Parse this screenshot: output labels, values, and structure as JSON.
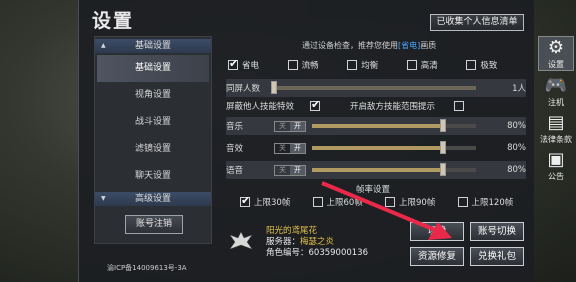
{
  "title": "设置",
  "top_button": "已收集个人信息清单",
  "left_menu": {
    "cat1": "基础设置",
    "items": [
      "基础设置",
      "视角设置",
      "战斗设置",
      "滤镜设置",
      "聊天设置"
    ],
    "cat2": "高级设置",
    "account_button": "账号注销",
    "icp": "渝ICP备14009613号-3A"
  },
  "hint": {
    "pre": "通过设备检查，推荐您使用",
    "link": "[省电]",
    "post": "画质"
  },
  "quality": [
    "省电",
    "流畅",
    "均衡",
    "高清",
    "极致"
  ],
  "rows": {
    "players_label": "同屏人数",
    "players_value": "1人",
    "hide_label": "屏蔽他人技能特效",
    "enemy_label": "开启敌方技能范围提示",
    "music": "音乐",
    "sfx": "音效",
    "voice": "语音",
    "off": "关",
    "on": "开",
    "music_value": "80%",
    "sfx_value": "80%",
    "voice_value": "80%"
  },
  "volume_levels": {
    "music": 0.8,
    "sfx": 0.8,
    "voice": 0.8,
    "players": 0.0
  },
  "fps": {
    "title": "帧率设置",
    "options": [
      "上限30帧",
      "上限60帧",
      "上限90帧",
      "上限120帧"
    ]
  },
  "account": {
    "name": "阳光的鸢尾花",
    "server_label": "服务器：",
    "server": "梅瑟之炎",
    "role_id": "角色编号：60359000136"
  },
  "buttons": {
    "switch": "切换",
    "account_switch": "账号切换",
    "repair": "资源修复",
    "gift": "兑换礼包"
  },
  "right_side": [
    "设置",
    "注机",
    "法律条款",
    "公告"
  ],
  "colors": {
    "accent": "#4aa3ff",
    "name": "#e0c24a",
    "arrow": "#e8294a"
  }
}
